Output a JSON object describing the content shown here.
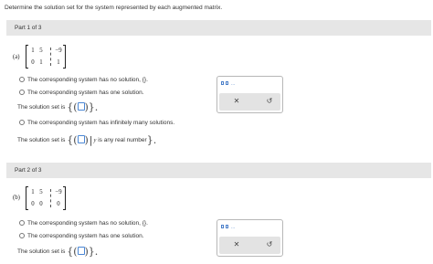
{
  "instructions": "Determine the solution set for the system represented by each augmented matrix.",
  "parts": [
    {
      "header": "Part 1 of 3",
      "label": "(a)",
      "matrix": [
        [
          "1",
          "5",
          "−9"
        ],
        [
          "0",
          "1",
          "1"
        ]
      ],
      "options": {
        "no_solution": "The corresponding system has no solution, {}.",
        "one_solution": "The corresponding system has one solution.",
        "solution_set_prefix": "The solution set is",
        "infinite": "The corresponding system has infinitely many solutions.",
        "infinite_set_prefix": "The solution set is",
        "y_var": "y",
        "any_real": "is any real number"
      }
    },
    {
      "header": "Part 2 of 3",
      "label": "(b)",
      "matrix": [
        [
          "1",
          "5",
          "−9"
        ],
        [
          "0",
          "0",
          "0"
        ]
      ],
      "options": {
        "no_solution": "The corresponding system has no solution, {}.",
        "one_solution": "The corresponding system has one solution.",
        "solution_set_prefix": "The solution set is"
      }
    }
  ],
  "tools": {
    "clear_symbol": "✕",
    "undo_symbol": "↺",
    "icon": "ordered-pair-template-icon"
  },
  "colors": {
    "accent": "#4a86d4",
    "part_bar": "#e6e6e6",
    "tool_bar": "#e3e3e3"
  }
}
